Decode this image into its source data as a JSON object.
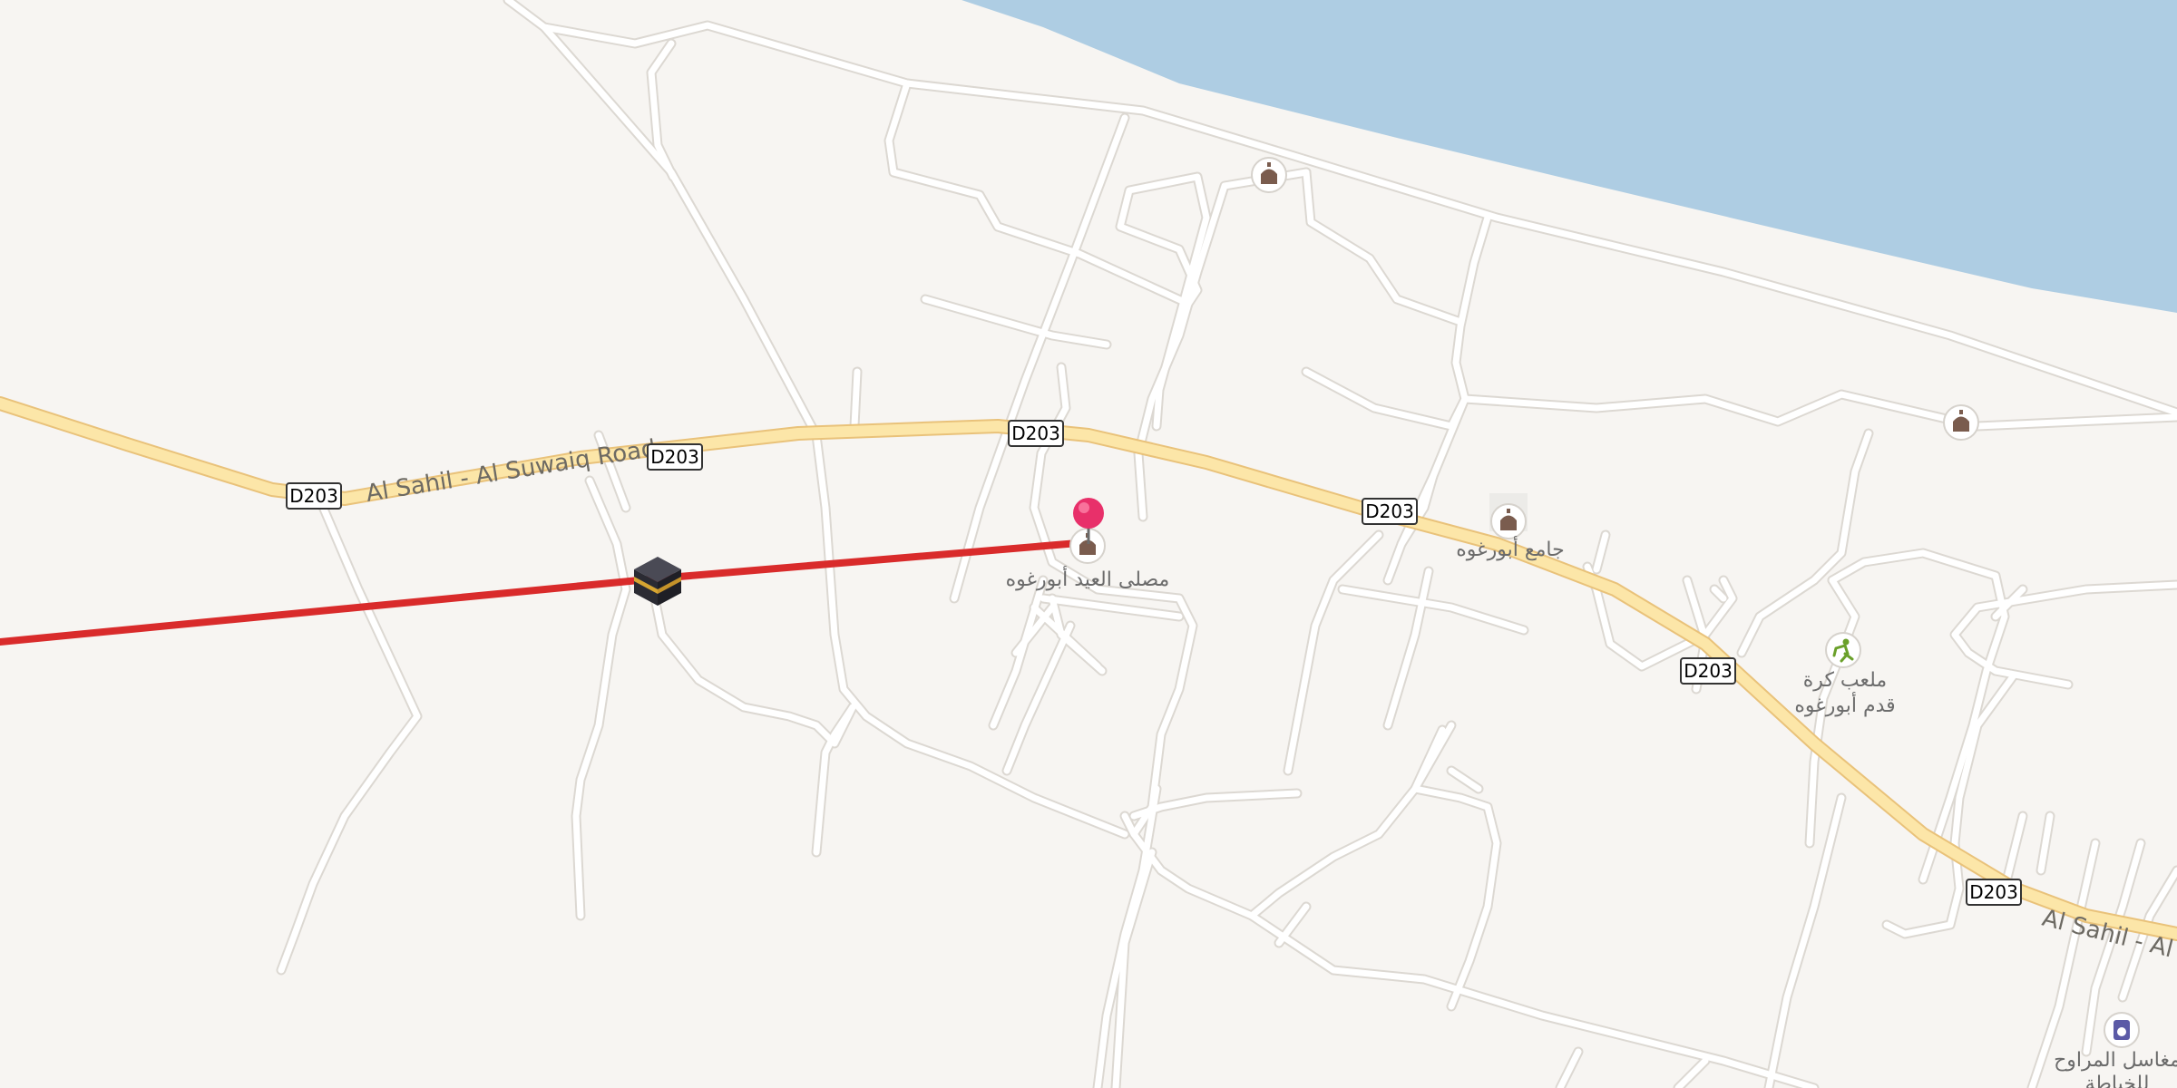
{
  "map": {
    "colors": {
      "land": "#f7f5f2",
      "water": "#aecde3",
      "minor_road": "#ffffff",
      "minor_road_casing": "#dcd8d2",
      "main_road": "#fce6a8",
      "main_road_casing": "#e9c27a",
      "route_line": "#d92b2b",
      "pin": "#e8306a",
      "mosque_icon": "#7a5c4e",
      "pitch_icon": "#6aa02a",
      "laundry_icon": "#5b5aa6"
    },
    "road_labels": {
      "west": "Al Sahil - Al Suwaiq Road",
      "east": "Al Sahil - Al Suwaiq Road"
    },
    "route_shields": [
      "D203",
      "D203",
      "D203",
      "D203",
      "D203",
      "D203"
    ],
    "poi": {
      "eid_prayer_ground": "مصلى العيد أبورغوه",
      "mosque": "جامع أبورغوه",
      "football_pitch_line1": "ملعب كرة",
      "football_pitch_line2": "قدم أبورغوه",
      "laundry_line1": "مغاسل المراوح",
      "laundry_line2": "للخياطة"
    },
    "icons": {
      "pin": "location-pin-icon",
      "route_marker": "kaaba-icon",
      "mosque": "mosque-icon",
      "pitch": "football-pitch-icon",
      "laundry": "laundry-icon"
    }
  }
}
